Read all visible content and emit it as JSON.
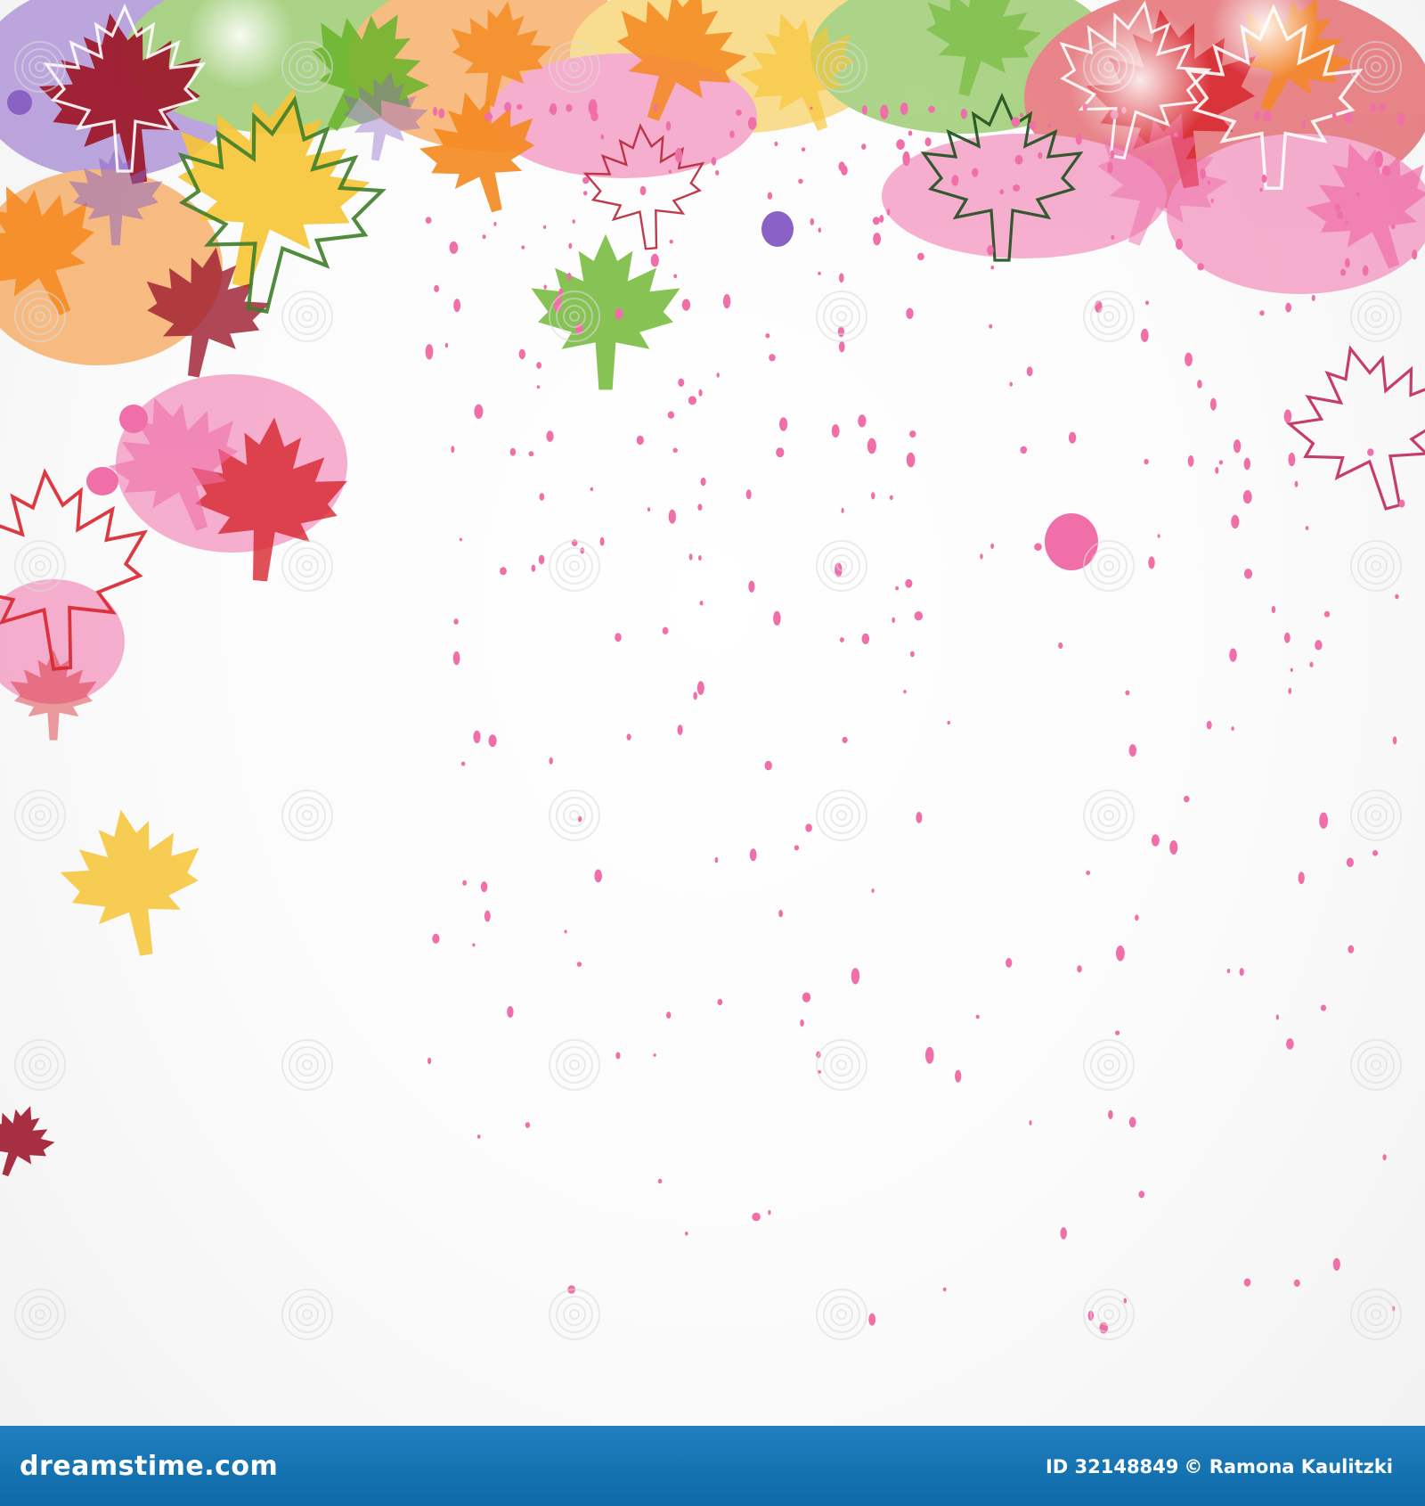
{
  "image": {
    "subject": "autumn maple leaves watercolor background",
    "palette": {
      "red": "#d8262e",
      "dark_red": "#9e1b2e",
      "orange": "#f5891f",
      "yellow": "#f7c535",
      "green": "#6ab42a",
      "purple": "#8a62c6",
      "pink": "#f06fa8",
      "footer_blue": "#1776b6"
    }
  },
  "footer": {
    "brand": "dreamstime.com",
    "id_label": "ID 32148849",
    "copyright": "© Ramona Kaulitzki"
  }
}
